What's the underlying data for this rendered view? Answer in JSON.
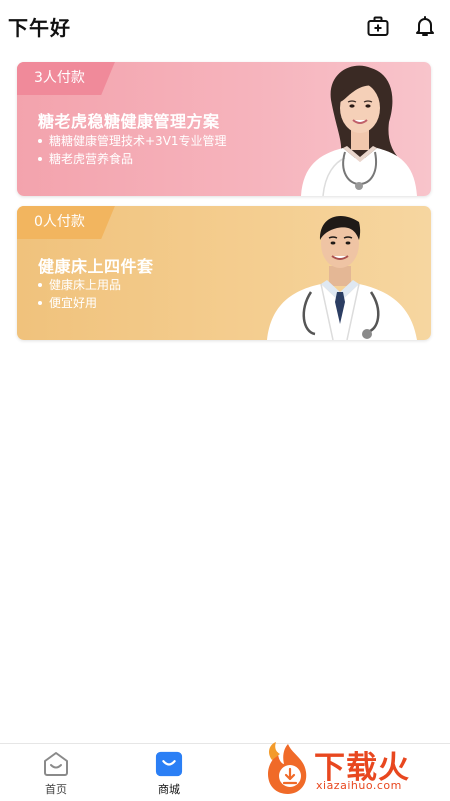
{
  "header": {
    "greeting": "下午好",
    "icons": [
      "medical-kit-icon",
      "bell-icon"
    ]
  },
  "cards": [
    {
      "badge": "3人付款",
      "title": "糖老虎稳糖健康管理方案",
      "features": [
        "糖糖健康管理技术+3V1专业管理",
        "糖老虎营养食品"
      ],
      "color": "#f4a6b0",
      "image": "female-doctor"
    },
    {
      "badge": "0人付款",
      "title": "健康床上四件套",
      "features": [
        "健康床上用品",
        "便宜好用"
      ],
      "color": "#f2c684",
      "image": "male-doctor"
    }
  ],
  "bottom_nav": {
    "items": [
      {
        "label": "首页",
        "icon": "home-icon",
        "active": false
      },
      {
        "label": "商城",
        "icon": "shop-icon",
        "active": true
      }
    ],
    "active_color": "#2b7ff5"
  },
  "watermark": {
    "text": "下载火",
    "url": "xiazaihuo.com"
  }
}
